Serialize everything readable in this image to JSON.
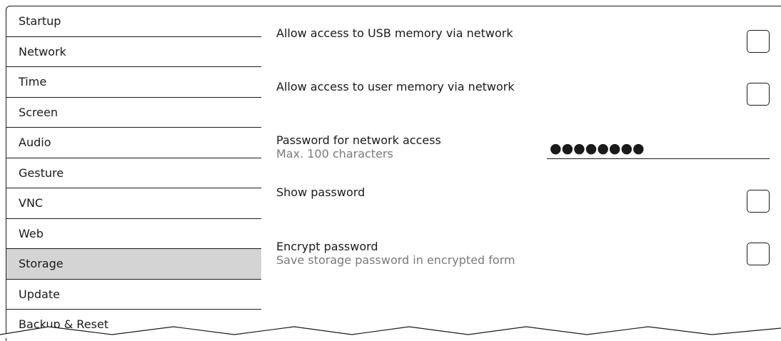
{
  "sidebar": {
    "items": [
      {
        "label": "Startup"
      },
      {
        "label": "Network"
      },
      {
        "label": "Time"
      },
      {
        "label": "Screen"
      },
      {
        "label": "Audio"
      },
      {
        "label": "Gesture"
      },
      {
        "label": "VNC"
      },
      {
        "label": "Web"
      },
      {
        "label": "Storage",
        "selected": true
      },
      {
        "label": "Update"
      },
      {
        "label": "Backup & Reset"
      }
    ]
  },
  "settings": {
    "usb_access": {
      "label": "Allow access to USB memory via network",
      "checked": false
    },
    "user_memory_access": {
      "label": "Allow access to user memory via network",
      "checked": false
    },
    "password": {
      "label": "Password for network access",
      "hint": "Max. 100 characters",
      "value": "●●●●●●●●"
    },
    "show_password": {
      "label": "Show password",
      "checked": false
    },
    "encrypt_password": {
      "label": "Encrypt password",
      "hint": "Save storage password in encrypted form",
      "checked": false
    }
  },
  "colors": {
    "selected_background": "#d4d4d4",
    "hint_text": "#7a7a7a",
    "border": "#1a1a1a"
  }
}
